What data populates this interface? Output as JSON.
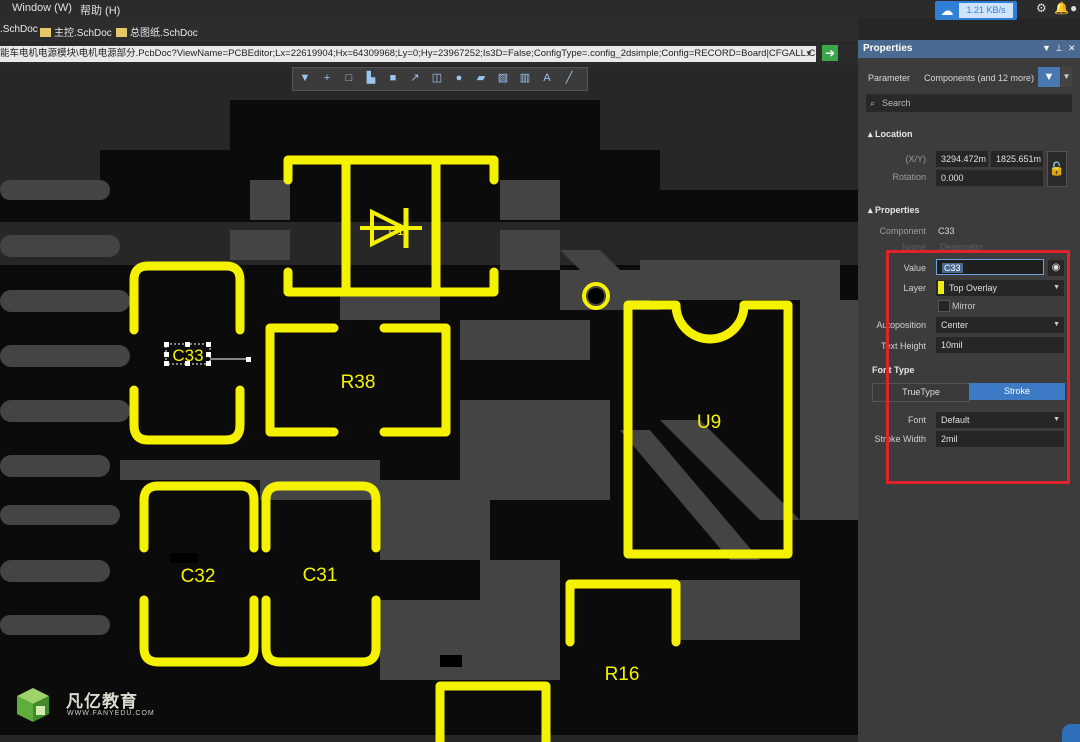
{
  "menu": {
    "window": "Window (W)",
    "help": "帮助 (H)"
  },
  "tabs": [
    {
      "label": ".SchDoc"
    },
    {
      "label": "主控.SchDoc"
    },
    {
      "label": "总图纸.SchDoc"
    }
  ],
  "address": {
    "value": "能车电机电源模块\\电机电源部分.PcbDoc?ViewName=PCBEditor;Lx=22619904;Hx=64309968;Ly=0;Hy=23967252;Is3D=False;ConfigType=.config_2dsimple;Config=RECORD=Board|CFGALL.CO"
  },
  "network": {
    "speed": "1.21 KB/s"
  },
  "toolbar": {
    "text_tool": "A"
  },
  "pcb": {
    "designators": {
      "c33": "C33",
      "r38": "R38",
      "u9": "U9",
      "c32": "C32",
      "c31": "C31",
      "r16": "R16",
      "d1": "D1"
    }
  },
  "panel": {
    "title": "Properties",
    "tab_parameter": "Parameter",
    "tab_components": "Components (and 12 more)",
    "search_placeholder": "Search",
    "location_section": "Location",
    "xy_label": "(X/Y)",
    "x_value": "3294.472m",
    "y_value": "1825.651m",
    "rotation_label": "Rotation",
    "rotation_value": "0.000",
    "properties_section": "Properties",
    "component_label": "Component",
    "component_value": "C33",
    "name_label": "Name",
    "name_value": "Designator",
    "value_label": "Value",
    "value_value": "C33",
    "layer_label": "Layer",
    "layer_value": "Top Overlay",
    "mirror_label": "Mirror",
    "autoposition_label": "Autoposition",
    "autoposition_value": "Center",
    "text_height_label": "Text Height",
    "text_height_value": "10mil",
    "font_type_section": "Font Type",
    "truetype_label": "TrueType",
    "stroke_label": "Stroke",
    "font_label": "Font",
    "font_value": "Default",
    "stroke_width_label": "Stroke Width",
    "stroke_width_value": "2mil"
  },
  "logo": {
    "name": "凡亿教育",
    "url": "WWW.FANYEDU.COM"
  },
  "colors": {
    "silkscreen": "#f5f200",
    "highlight": "#e0232b",
    "panel_title": "#4a6a92",
    "accent_blue": "#2f7fd6"
  }
}
